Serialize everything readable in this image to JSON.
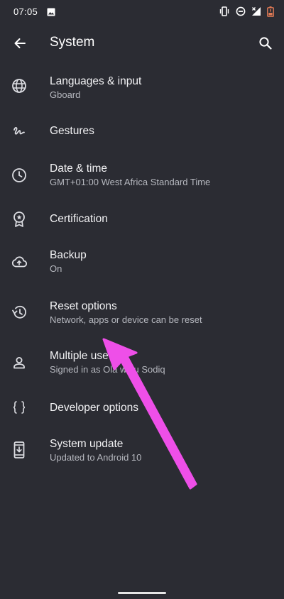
{
  "status_bar": {
    "time": "07:05",
    "icons": [
      "image-icon",
      "vibrate-icon",
      "do-not-disturb-icon",
      "signal-x-icon",
      "battery-icon"
    ]
  },
  "app_bar": {
    "title": "System",
    "back_icon": "arrow-left-icon",
    "search_icon": "search-icon"
  },
  "items": [
    {
      "id": "languages",
      "icon": "globe-icon",
      "title": "Languages & input",
      "subtitle": "Gboard"
    },
    {
      "id": "gestures",
      "icon": "gesture-icon",
      "title": "Gestures",
      "subtitle": ""
    },
    {
      "id": "date-time",
      "icon": "clock-icon",
      "title": "Date & time",
      "subtitle": "GMT+01:00 West Africa Standard Time"
    },
    {
      "id": "certification",
      "icon": "badge-icon",
      "title": "Certification",
      "subtitle": ""
    },
    {
      "id": "backup",
      "icon": "cloud-upload-icon",
      "title": "Backup",
      "subtitle": "On"
    },
    {
      "id": "reset",
      "icon": "history-icon",
      "title": "Reset options",
      "subtitle": "Network, apps or device can be reset"
    },
    {
      "id": "multiple-users",
      "icon": "person-icon",
      "title": "Multiple use",
      "subtitle": "Signed in as Ola    waju Sodiq"
    },
    {
      "id": "developer",
      "icon": "braces-icon",
      "title": "Developer options",
      "subtitle": ""
    },
    {
      "id": "system-update",
      "icon": "system-update-icon",
      "title": "System update",
      "subtitle": "Updated to Android 10"
    }
  ],
  "colors": {
    "background": "#2b2c33",
    "text_primary": "#f2f2f4",
    "text_secondary": "#b6b8bf",
    "arrow": "#ee4fe8"
  }
}
